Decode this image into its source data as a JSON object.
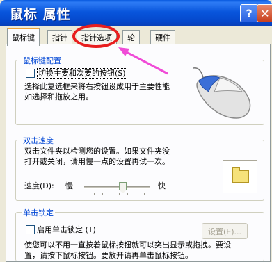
{
  "window": {
    "title": "鼠标 属性",
    "help_label": "?",
    "close_label": "✕"
  },
  "tabs": [
    {
      "label": "鼠标键",
      "active": true
    },
    {
      "label": "指针",
      "active": false
    },
    {
      "label": "指针选项",
      "active": false
    },
    {
      "label": "轮",
      "active": false
    },
    {
      "label": "硬件",
      "active": false
    }
  ],
  "buttons_config": {
    "title": "鼠标键配置",
    "swap_label": "切换主要和次要的按钮",
    "swap_shortcut": "(S)",
    "swap_checked": false,
    "desc_line1": "选择此复选框来将右按钮设成用于主要性能",
    "desc_line2": "如选择和拖放之用。"
  },
  "double_click": {
    "title": "双击速度",
    "desc_line1": "双击文件夹以检测您的设置。如果文件夹没",
    "desc_line2": "打开或关闭，请用慢一点的设置再试一次。",
    "speed_label": "速度",
    "speed_shortcut": "(D):",
    "slow_label": "慢",
    "fast_label": "快",
    "speed_fraction": 0.58
  },
  "click_lock": {
    "title": "单击锁定",
    "enable_label": "启用单击锁定",
    "enable_shortcut": "(T)",
    "enable_checked": false,
    "settings_label": "设置(E)...",
    "desc_line1": "使您可以不用一直按着鼠标按钮就可以突出显示或拖拽。要设",
    "desc_line2": "置，请按下鼠标按钮。要放开请再单击鼠标按钮。"
  },
  "colors": {
    "title_bar": "#0855dc",
    "highlight_circle": "#e81e1e",
    "arrow": "#f04bd7",
    "group_title": "#0046d5"
  }
}
